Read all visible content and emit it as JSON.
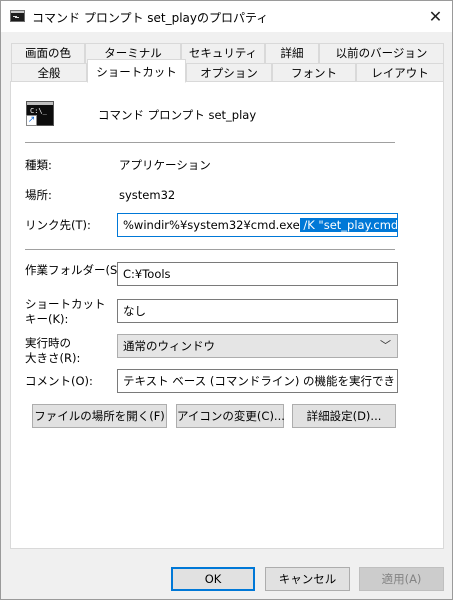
{
  "window": {
    "title": "コマンド プロンプト set_playのプロパティ",
    "close_glyph": "✕"
  },
  "tabs": {
    "row1": [
      "画面の色",
      "ターミナル",
      "セキュリティ",
      "詳細",
      "以前のバージョン"
    ],
    "row2": [
      "全般",
      "ショートカット",
      "オプション",
      "フォント",
      "レイアウト"
    ],
    "active": "ショートカット"
  },
  "shortcut": {
    "name": "コマンド プロンプト set_play",
    "icon": "cmd-icon",
    "type_label": "種類:",
    "type_value": "アプリケーション",
    "location_label": "場所:",
    "location_value": "system32",
    "target_label": "リンク先(T):",
    "target_value_plain": "%windir%¥system32¥cmd.exe",
    "target_value_selected": " /K \"set_play.cmd\"",
    "start_in_label": "作業フォルダー(S):",
    "start_in_value": "C:¥Tools",
    "hotkey_label_line1": "ショートカット",
    "hotkey_label_line2": "キー(K):",
    "hotkey_value": "なし",
    "run_label_line1": "実行時の",
    "run_label_line2": "大きさ(R):",
    "run_value": "通常のウィンドウ",
    "comment_label": "コメント(O):",
    "comment_value": "テキスト ベース (コマンドライン) の機能を実行できます。"
  },
  "buttons": {
    "open_location": "ファイルの場所を開く(F)",
    "change_icon": "アイコンの変更(C)...",
    "advanced": "詳細設定(D)...",
    "ok": "OK",
    "cancel": "キャンセル",
    "apply": "適用(A)"
  }
}
